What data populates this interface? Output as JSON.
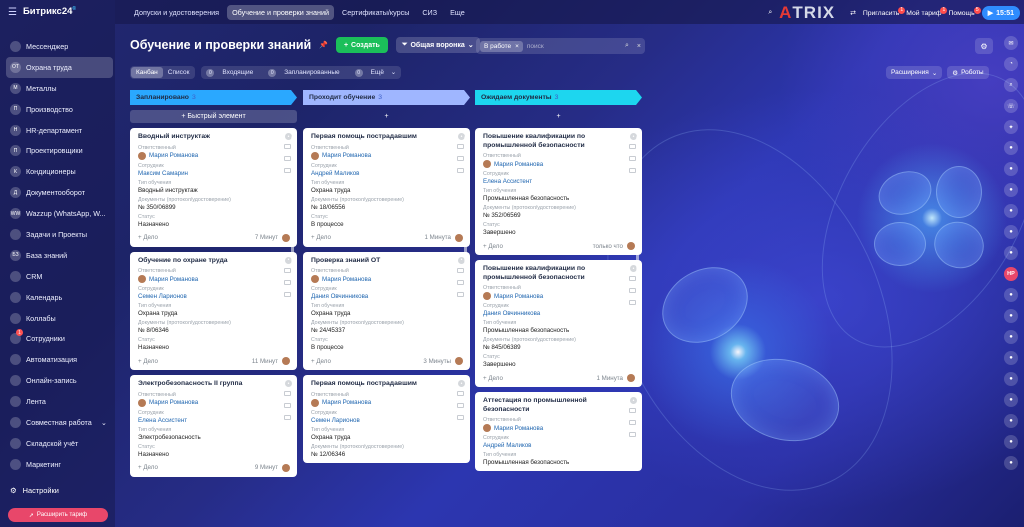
{
  "app": {
    "logo": "Битрикс24",
    "sup": "®"
  },
  "sidebar": {
    "items": [
      {
        "label": "Мессенджер",
        "icon": "chat-icon",
        "active": false
      },
      {
        "label": "Охрана труда",
        "icon": "OT",
        "active": true
      },
      {
        "label": "Металлы",
        "icon": "M",
        "active": false
      },
      {
        "label": "Производство",
        "icon": "П",
        "active": false
      },
      {
        "label": "HR-департамент",
        "icon": "H",
        "active": false
      },
      {
        "label": "Проектировщики",
        "icon": "П",
        "active": false
      },
      {
        "label": "Кондиционеры",
        "icon": "К",
        "active": false
      },
      {
        "label": "Документооборот",
        "icon": "Д",
        "active": false
      },
      {
        "label": "Wazzup (WhatsApp, W...",
        "icon": "WW",
        "active": false
      },
      {
        "label": "Задачи и Проекты",
        "icon": "check-icon",
        "active": false
      },
      {
        "label": "База знаний",
        "icon": "БЗ",
        "active": false
      },
      {
        "label": "CRM",
        "icon": "crm-icon",
        "active": false
      },
      {
        "label": "Календарь",
        "icon": "calendar-icon",
        "active": false
      },
      {
        "label": "Коллабы",
        "icon": "collab-icon",
        "active": false
      },
      {
        "label": "Сотрудники",
        "icon": "people-icon",
        "active": false,
        "badge": "1"
      },
      {
        "label": "Автоматизация",
        "icon": "automation-icon",
        "active": false
      },
      {
        "label": "Онлайн-запись",
        "icon": "booking-icon",
        "active": false
      },
      {
        "label": "Лента",
        "icon": "feed-icon",
        "active": false
      },
      {
        "label": "Совместная работа",
        "icon": "cowork-icon",
        "active": false,
        "chevron": "⌄"
      },
      {
        "label": "Складской учёт",
        "icon": "warehouse-icon",
        "active": false
      },
      {
        "label": "Маркетинг",
        "icon": "marketing-icon",
        "active": false
      }
    ],
    "settings": "Настройки",
    "upgrade": "Расширить тариф"
  },
  "topbar": {
    "tabs": [
      "Допуски и удостоверения",
      "Обучение и проверки знаний",
      "Сертификаты/курсы",
      "СИЗ",
      "Еще"
    ],
    "active_tab": 1,
    "brand_a": "A",
    "brand_rest": "TRIX",
    "invite": "Пригласить",
    "invite_badge": "1",
    "tariff": "Мой тариф",
    "tariff_badge": "1",
    "help": "Помощь",
    "help_badge": "5",
    "clock": "15:51"
  },
  "header": {
    "title": "Обучение и проверки знаний",
    "create": "Создать",
    "funnel": "Общая воронка",
    "filter_chip": "В работе",
    "search_placeholder": "поиск"
  },
  "toolbar": {
    "views": [
      "Канбан",
      "Список"
    ],
    "incoming": "Входящие",
    "planned": "Запланированные",
    "more": "Ещё",
    "extensions": "Расширения",
    "robots": "Роботы"
  },
  "colors": {
    "col1": "#2aa8ff",
    "col2": "#9fb6ff",
    "col3": "#1dd6ef"
  },
  "columns": [
    {
      "title": "Запланировано",
      "count": "3",
      "quick_add": "Быстрый элемент",
      "cards": [
        {
          "title": "Вводный инструктаж",
          "resp_label": "Ответственный",
          "resp": "Мария Романова",
          "emp_label": "Сотрудник",
          "emp": "Максим Самарин",
          "type_label": "Тип обучения",
          "type": "Вводный инструктаж",
          "doc_label": "Документы (протокол/удостоверение)",
          "doc": "№ 350/06899",
          "status_label": "Статус",
          "status": "Назначено",
          "add": "+ Дело",
          "time": "7 Минут"
        },
        {
          "title": "Обучение по охране труда",
          "resp_label": "Ответственный",
          "resp": "Мария Романова",
          "emp_label": "Сотрудник",
          "emp": "Семен Ларионов",
          "type_label": "Тип обучения",
          "type": "Охрана труда",
          "doc_label": "Документы (протокол/удостоверение)",
          "doc": "№ 8/06346",
          "status_label": "Статус",
          "status": "Назначено",
          "add": "+ Дело",
          "time": "11 Минут"
        },
        {
          "title": "Электробезопасность II группа",
          "resp_label": "Ответственный",
          "resp": "Мария Романова",
          "emp_label": "Сотрудник",
          "emp": "Елена Ассистент",
          "type_label": "Тип обучения",
          "type": "Электробезопасность",
          "status_label": "Статус",
          "status": "Назначено",
          "add": "+ Дело",
          "time": "9 Минут"
        }
      ]
    },
    {
      "title": "Проходит обучение",
      "count": "3",
      "cards": [
        {
          "title": "Первая помощь пострадавшим",
          "resp_label": "Ответственный",
          "resp": "Мария Романова",
          "emp_label": "Сотрудник",
          "emp": "Андрей Маликов",
          "type_label": "Тип обучения",
          "type": "Охрана труда",
          "doc_label": "Документы (протокол/удостоверение)",
          "doc": "№ 18/06556",
          "status_label": "Статус",
          "status": "В процессе",
          "add": "+ Дело",
          "time": "1 Минута"
        },
        {
          "title": "Проверка знаний ОТ",
          "resp_label": "Ответственный",
          "resp": "Мария Романова",
          "emp_label": "Сотрудник",
          "emp": "Дания Овчинникова",
          "type_label": "Тип обучения",
          "type": "Охрана труда",
          "doc_label": "Документы (протокол/удостоверение)",
          "doc": "№ 24/45337",
          "status_label": "Статус",
          "status": "В процессе",
          "add": "+ Дело",
          "time": "3 Минуты"
        },
        {
          "title": "Первая помощь пострадавшим",
          "resp_label": "Ответственный",
          "resp": "Мария Романова",
          "emp_label": "Сотрудник",
          "emp": "Семен Ларионов",
          "type_label": "Тип обучения",
          "type": "Охрана труда",
          "doc_label": "Документы (протокол/удостоверение)",
          "doc": "№ 12/06346"
        }
      ]
    },
    {
      "title": "Ожидаем документы",
      "count": "3",
      "cards": [
        {
          "title": "Повышение квалификации по промышленной безопасности",
          "resp_label": "Ответственный",
          "resp": "Мария Романова",
          "emp_label": "Сотрудник",
          "emp": "Елена Ассистент",
          "type_label": "Тип обучения",
          "type": "Промышленная безопасность",
          "doc_label": "Документы (протокол/удостоверение)",
          "doc": "№ 352/06569",
          "status_label": "Статус",
          "status": "Завершено",
          "add": "+ Дело",
          "time": "только что"
        },
        {
          "title": "Повышение квалификации по промышленной безопасности",
          "resp_label": "Ответственный",
          "resp": "Мария Романова",
          "emp_label": "Сотрудник",
          "emp": "Дания Овчинникова",
          "type_label": "Тип обучения",
          "type": "Промышленная безопасность",
          "doc_label": "Документы (протокол/удостоверение)",
          "doc": "№ 845/06389",
          "status_label": "Статус",
          "status": "Завершено",
          "add": "+ Дело",
          "time": "1 Минута"
        },
        {
          "title": "Аттестация по промышленной безопасности",
          "resp_label": "Ответственный",
          "resp": "Мария Романова",
          "emp_label": "Сотрудник",
          "emp": "Андрей Маликов",
          "type_label": "Тип обучения",
          "type": "Промышленная безопасность"
        }
      ]
    }
  ],
  "right_rail": {
    "hp": "HP"
  }
}
